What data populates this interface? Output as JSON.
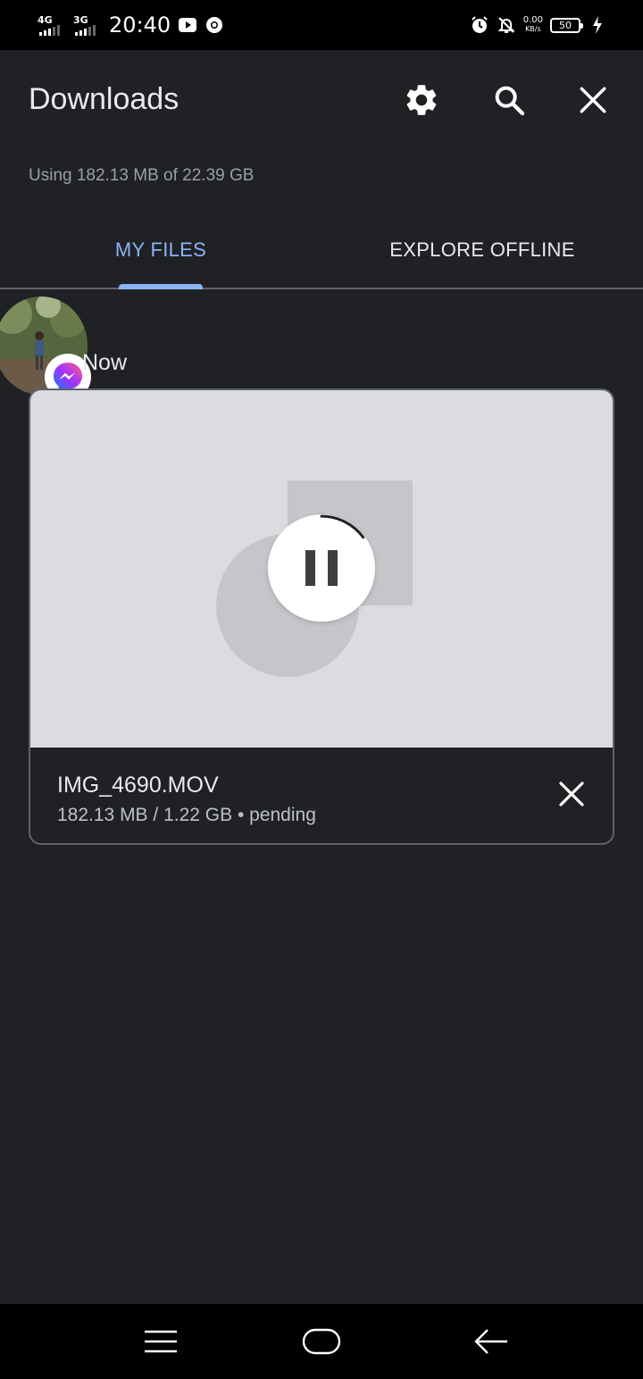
{
  "status_bar": {
    "network1": "4G",
    "network2": "3G",
    "time": "20:40",
    "speed_value": "0.00",
    "speed_unit": "KB/s",
    "battery": "50",
    "icons": [
      "youtube-icon",
      "chrome-icon",
      "alarm-icon",
      "notifications-off-icon",
      "charging-icon"
    ]
  },
  "header": {
    "title": "Downloads",
    "actions": [
      "settings-icon",
      "search-icon",
      "close-icon"
    ]
  },
  "storage": {
    "usage_text": "Using 182.13 MB of 22.39 GB"
  },
  "tabs": [
    {
      "label": "MY FILES",
      "active": true
    },
    {
      "label": "EXPLORE OFFLINE",
      "active": false
    }
  ],
  "section": {
    "label": "Now"
  },
  "download": {
    "file_name": "IMG_4690.MOV",
    "progress_text": "182.13 MB / 1.22 GB • pending",
    "progress_fraction": 0.149,
    "source_app_icon": "messenger-icon"
  },
  "colors": {
    "background": "#202124",
    "accent": "#8ab4f8",
    "text_primary": "#e8eaed",
    "text_secondary": "#9aa0a6"
  }
}
